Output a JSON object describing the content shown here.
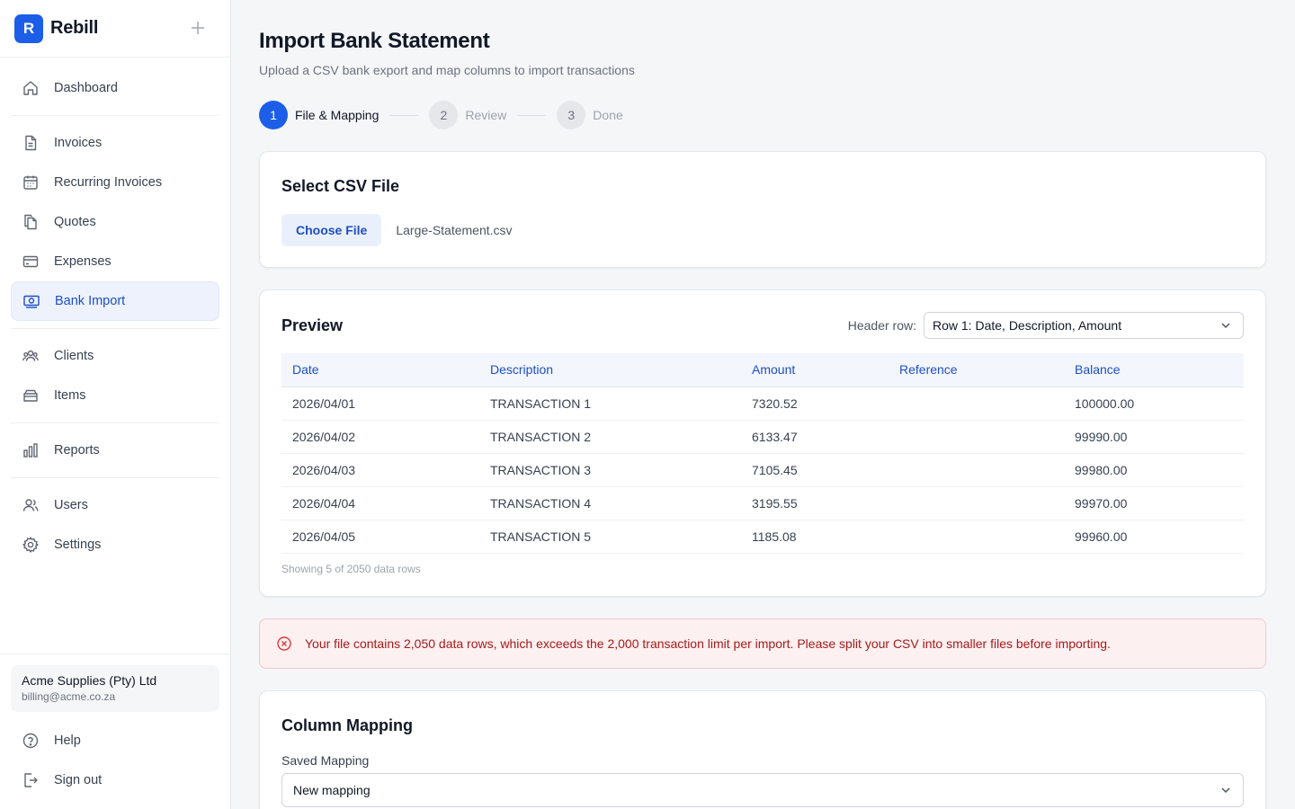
{
  "app": {
    "brand_initial": "R",
    "brand_name": "Rebill",
    "accent": "#1c5ee8"
  },
  "sidebar": {
    "nav": [
      {
        "label": "Dashboard",
        "icon": "home-icon"
      },
      {
        "label": "Invoices",
        "icon": "document-icon"
      },
      {
        "label": "Recurring Invoices",
        "icon": "calendar-icon"
      },
      {
        "label": "Quotes",
        "icon": "copy-icon"
      },
      {
        "label": "Expenses",
        "icon": "credit-card-icon"
      },
      {
        "label": "Bank Import",
        "icon": "cash-icon",
        "active": true
      },
      {
        "label": "Clients",
        "icon": "users-group-icon"
      },
      {
        "label": "Items",
        "icon": "box-icon"
      },
      {
        "label": "Reports",
        "icon": "bar-chart-icon"
      },
      {
        "label": "Users",
        "icon": "users-icon"
      },
      {
        "label": "Settings",
        "icon": "gear-icon"
      }
    ],
    "company": {
      "name": "Acme Supplies (Pty) Ltd",
      "email": "billing@acme.co.za"
    },
    "bottom": [
      {
        "label": "Help",
        "icon": "help-icon"
      },
      {
        "label": "Sign out",
        "icon": "sign-out-icon"
      }
    ]
  },
  "page": {
    "title": "Import Bank Statement",
    "subtitle": "Upload a CSV bank export and map columns to import transactions"
  },
  "stepper": [
    {
      "num": "1",
      "label": "File & Mapping",
      "active": true
    },
    {
      "num": "2",
      "label": "Review",
      "active": false
    },
    {
      "num": "3",
      "label": "Done",
      "active": false
    }
  ],
  "file_card": {
    "title": "Select CSV File",
    "button": "Choose File",
    "file_name": "Large-Statement.csv"
  },
  "preview": {
    "title": "Preview",
    "header_row_label": "Header row:",
    "header_row_value": "Row 1: Date, Description, Amount",
    "columns": [
      "Date",
      "Description",
      "Amount",
      "Reference",
      "Balance"
    ],
    "rows": [
      [
        "2026/04/01",
        "TRANSACTION 1",
        "7320.52",
        "",
        "100000.00"
      ],
      [
        "2026/04/02",
        "TRANSACTION 2",
        "6133.47",
        "",
        "99990.00"
      ],
      [
        "2026/04/03",
        "TRANSACTION 3",
        "7105.45",
        "",
        "99980.00"
      ],
      [
        "2026/04/04",
        "TRANSACTION 4",
        "3195.55",
        "",
        "99970.00"
      ],
      [
        "2026/04/05",
        "TRANSACTION 5",
        "1185.08",
        "",
        "99960.00"
      ]
    ],
    "note": "Showing 5 of 2050 data rows"
  },
  "alert": {
    "text": "Your file contains 2,050 data rows, which exceeds the 2,000 transaction limit per import. Please split your CSV into smaller files before importing.",
    "color": "#dc3b3b"
  },
  "mapping": {
    "title": "Column Mapping",
    "saved_label": "Saved Mapping",
    "saved_value": "New mapping"
  }
}
